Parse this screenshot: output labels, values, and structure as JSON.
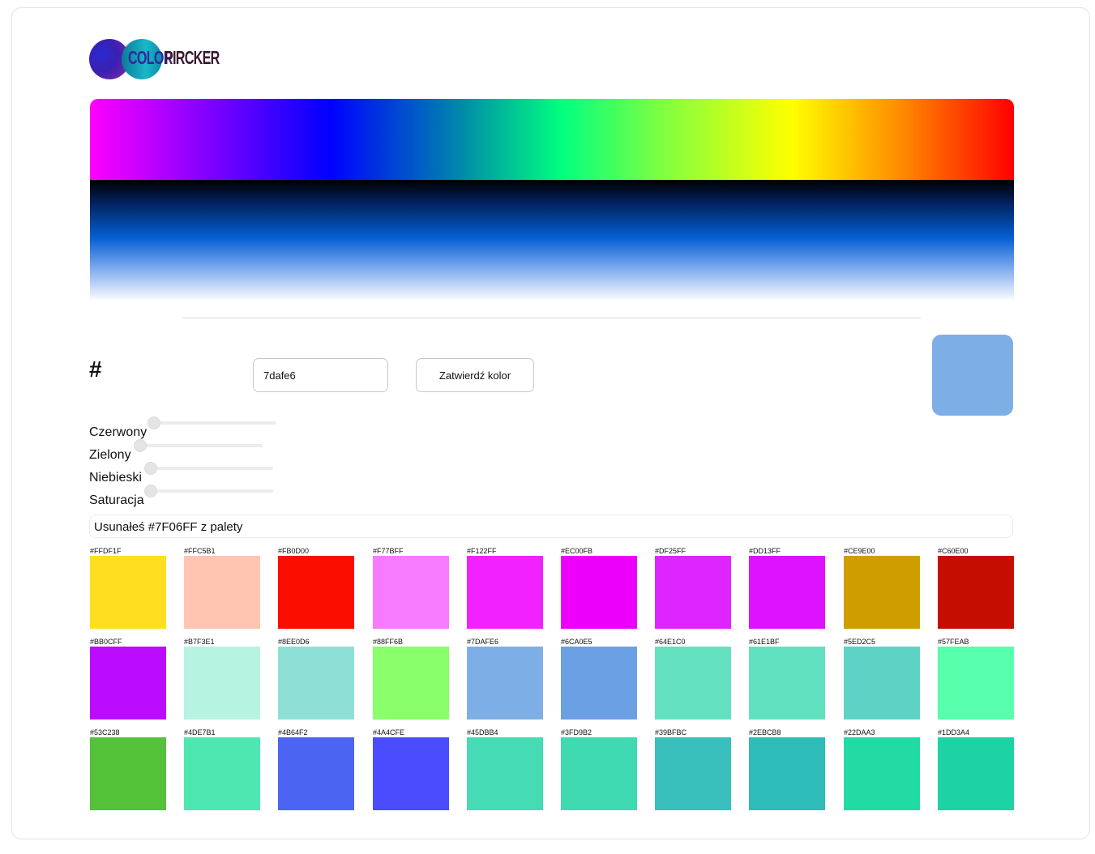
{
  "logo": {
    "text_part1": "COLOR",
    "text_part2": "PIRCKER"
  },
  "picker": {
    "hash_symbol": "#",
    "hex_value": "7dafe6",
    "confirm_label": "Zatwierdź kolor",
    "preview_color": "#7DAFE6"
  },
  "sliders": [
    {
      "label": "Czerwony",
      "value": 0
    },
    {
      "label": "Zielony",
      "value": 0
    },
    {
      "label": "Niebieski",
      "value": 0
    },
    {
      "label": "Saturacja",
      "value": 0
    }
  ],
  "message": "Usunałeś #7F06FF z palety",
  "palette": [
    "#FFDF1F",
    "#FFC5B1",
    "#FB0D00",
    "#F77BFF",
    "#F122FF",
    "#EC00FB",
    "#DF25FF",
    "#DD13FF",
    "#CE9E00",
    "#C60E00",
    "#BB0CFF",
    "#B7F3E1",
    "#8EE0D6",
    "#88FF6B",
    "#7DAFE6",
    "#6CA0E5",
    "#64E1C0",
    "#61E1BF",
    "#5ED2C5",
    "#57FEAB",
    "#53C238",
    "#4DE7B1",
    "#4B64F2",
    "#4A4CFE",
    "#45DBB4",
    "#3FD9B2",
    "#39BFBC",
    "#2EBCB8",
    "#22DAA3",
    "#1DD3A4"
  ]
}
